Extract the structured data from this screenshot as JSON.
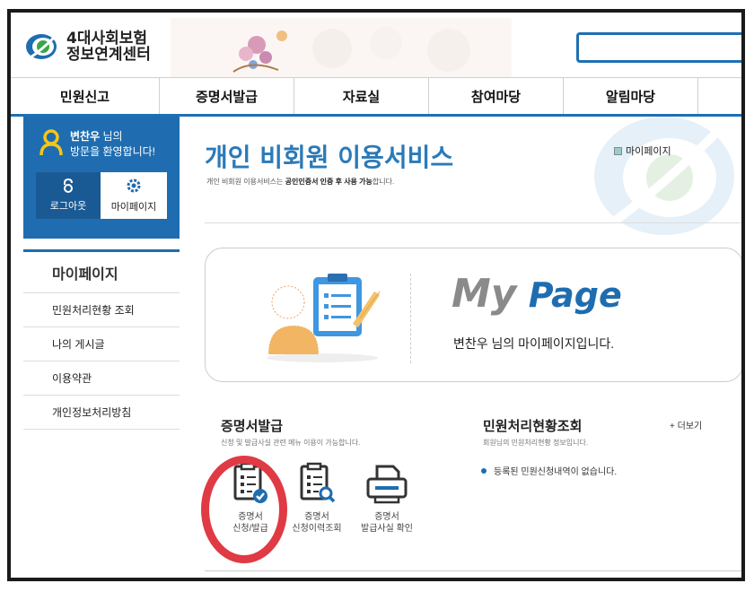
{
  "header": {
    "logo_line1": "4대사회보험",
    "logo_line2": "정보연계센터"
  },
  "nav": {
    "items": [
      "민원신고",
      "증명서발급",
      "자료실",
      "참여마당",
      "알림마당"
    ]
  },
  "sidebar": {
    "user_name": "변찬우",
    "user_suffix": " 님의",
    "welcome": "방문을 환영합니다!",
    "logout_label": "로그아웃",
    "mypage_label": "마이페이지",
    "menu_title": "마이페이지",
    "menu_items": [
      "민원처리현황 조회",
      "나의 게시글",
      "이용약관",
      "개인정보처리방침"
    ]
  },
  "main": {
    "title": "개인 비회원 이용서비스",
    "subtitle_pre": "개인 비회원 이용서비스는 ",
    "subtitle_bold": "공인인증서 인증 후 사용 가능",
    "subtitle_post": "합니다.",
    "mypage_link": "마이페이지",
    "card": {
      "logo_my": "My",
      "logo_page": "Page",
      "message": "변찬우 님의 마이페이지입니다."
    },
    "cert_section": {
      "title": "증명서발급",
      "subtitle": "신청 및 발급사실 관련 메뉴 이용이 가능합니다.",
      "services": [
        {
          "line1": "증명서",
          "line2": "신청/발급"
        },
        {
          "line1": "증명서",
          "line2": "신청이력조회"
        },
        {
          "line1": "증명서",
          "line2": "발급사실 확인"
        }
      ]
    },
    "status_section": {
      "title": "민원처리현황조회",
      "subtitle": "회원님의 민원처리현황 정보입니다.",
      "more": "+ 더보기",
      "empty": "등록된 민원신청내역이 없습니다."
    }
  },
  "colors": {
    "brand_blue": "#1f6db0",
    "highlight_red": "#e03a44"
  }
}
